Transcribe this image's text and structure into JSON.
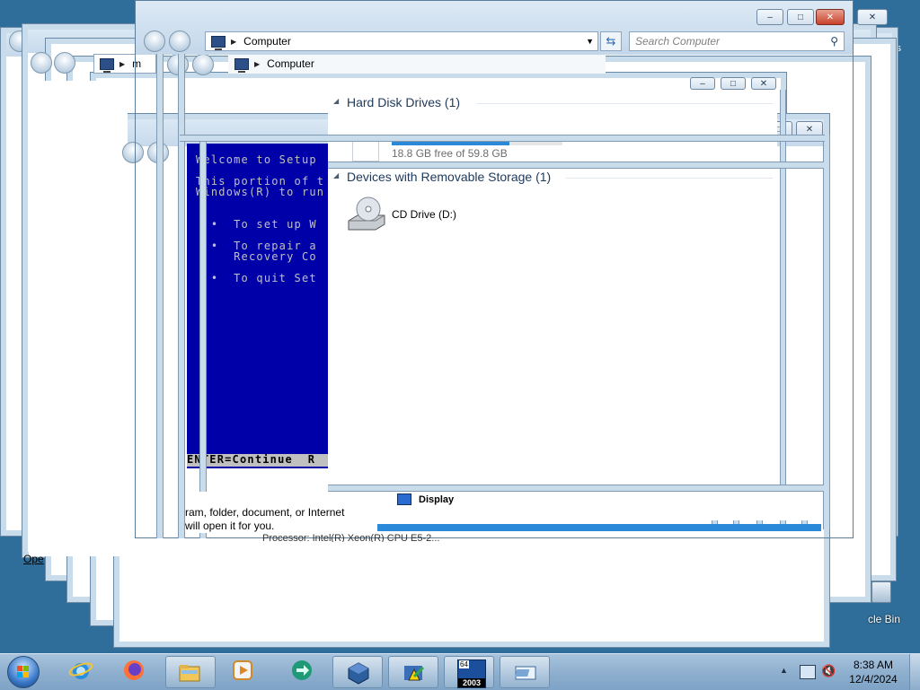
{
  "explorer": {
    "breadcrumb": "Computer",
    "search_placeholder": "Search Computer",
    "group_hdd": "Hard Disk Drives (1)",
    "drive_space": "18.8 GB free of 59.8 GB",
    "drive_usage_fraction": 0.69,
    "group_removable": "Devices with Removable Storage (1)",
    "cd_drive": "CD Drive (D:)"
  },
  "ghost_windows": {
    "breadcrumb_back": "Computer",
    "partial_title": "m",
    "run_dialog_line1": "ram, folder, document, or Internet",
    "run_dialog_line2": "will open it for you.",
    "display_label": "Display",
    "processor_text": "Processor: Intel(R) Xeon(R) CPU E5-2...",
    "open_label": "Ope",
    "recycle_bin": "cle Bin",
    "right_edge_text": "cs"
  },
  "setup_screen": {
    "lines": [
      "Welcome to Setup",
      "",
      "This portion of t",
      "Windows(R) to run",
      "",
      "",
      "  •  To set up W",
      "",
      "  •  To repair a",
      "     Recovery Co",
      "",
      "  •  To quit Set"
    ],
    "status_bar": "ENTER=Continue  R"
  },
  "taskbar": {
    "apps": [
      {
        "name": "internet-explorer",
        "icon": "ie-icon"
      },
      {
        "name": "firefox",
        "icon": "firefox-icon"
      },
      {
        "name": "windows-explorer",
        "icon": "folder-icon"
      },
      {
        "name": "media-player",
        "icon": "media-player-icon"
      },
      {
        "name": "app-green",
        "icon": "green-app-icon"
      },
      {
        "name": "virtualbox",
        "icon": "virtualbox-icon"
      },
      {
        "name": "task-tool",
        "icon": "task-tool-icon"
      },
      {
        "name": "windows-2003",
        "icon": "windows-2003-icon"
      },
      {
        "name": "remote-desktop",
        "icon": "rdp-icon"
      }
    ],
    "badge_64": "64",
    "badge_2003": "2003",
    "time": "8:38 AM",
    "date": "12/4/2024"
  },
  "colors": {
    "desktop": "#2f6e9a",
    "setup_blue": "#0000a8",
    "accent": "#1e395b"
  }
}
